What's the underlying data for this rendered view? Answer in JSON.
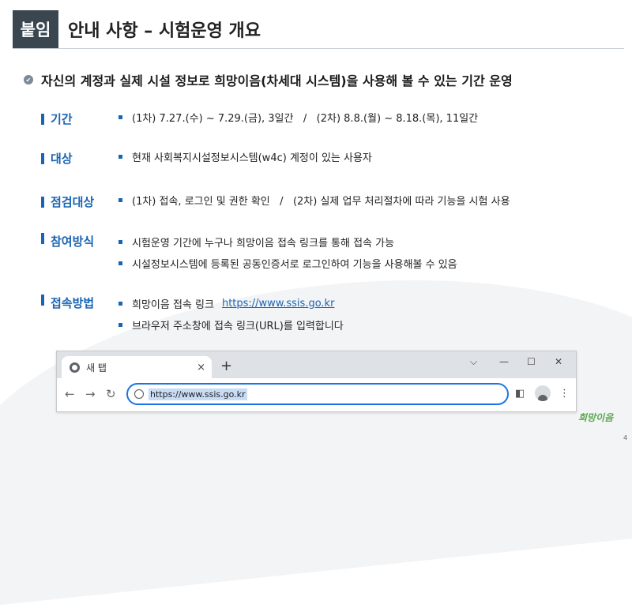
{
  "header": {
    "badge": "붙임",
    "title": "안내 사항 – 시험운영 개요"
  },
  "headline": "자신의 계정과 실제 시설 정보로 희망이음(차세대 시스템)을 사용해 볼 수 있는 기간 운영",
  "sections": [
    {
      "label": "기간",
      "items": [
        "(1차) 7.27.(수) ~ 7.29.(금), 3일간   /   (2차) 8.8.(월) ~ 8.18.(목), 11일간"
      ]
    },
    {
      "label": "대상",
      "items": [
        "현재 사회복지시설정보시스템(w4c) 계정이 있는 사용자"
      ]
    },
    {
      "label": "점검대상",
      "items": [
        "(1차) 접속, 로그인 및 권한 확인   /   (2차) 실제 업무 처리절차에 따라 기능을 시험 사용"
      ]
    },
    {
      "label": "참여방식",
      "items": [
        "시험운영 기간에 누구나 희망이음 접속 링크를 통해 접속 가능",
        "시설정보시스템에 등록된 공동인증서로 로그인하여 기능을 사용해볼 수 있음"
      ]
    },
    {
      "label": "접속방법",
      "items": [
        "희망이음 접속 링크",
        "브라우저 주소창에 접속 링크(URL)를 입력합니다"
      ],
      "link": "https://www.ssis.go.kr"
    }
  ],
  "browser": {
    "tab_title": "새 탭",
    "tab_close": "×",
    "new_tab": "+",
    "url": "https://www.ssis.go.kr",
    "controls": {
      "chevron": "⌵",
      "minimize": "—",
      "maximize": "☐",
      "close": "✕"
    },
    "nav": {
      "back": "←",
      "forward": "→",
      "reload": "↻"
    },
    "icons": {
      "sidepanel": "◧",
      "menu": "⋮"
    }
  },
  "logo": {
    "text": "희망이음"
  },
  "page_number": "4"
}
